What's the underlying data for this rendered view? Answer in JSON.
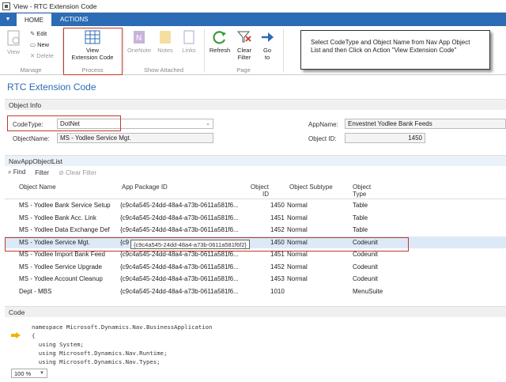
{
  "window": {
    "title": "View - RTC Extension Code"
  },
  "tabs": [
    {
      "label": "HOME"
    },
    {
      "label": "ACTIONS"
    }
  ],
  "ribbon": {
    "view_label": "View",
    "edit_label": "Edit",
    "new_label": "New",
    "delete_label": "Delete",
    "manage_group": "Manage",
    "view_ext_line1": "View",
    "view_ext_line2": "Extension Code",
    "process_group": "Process",
    "onenote_label": "OneNote",
    "notes_label": "Notes",
    "links_label": "Links",
    "show_attached_group": "Show Attached",
    "refresh_label": "Refresh",
    "clear_filter_line1": "Clear",
    "clear_filter_line2": "Filter",
    "goto_line1": "Go",
    "goto_line2": "to",
    "page_group": "Page"
  },
  "callout": {
    "text": "Select CodeType and Object Name from Nav App Object List and then Click on Action \"View Extension Code\""
  },
  "page_title": "RTC Extension Code",
  "object_info": {
    "header": "Object Info",
    "codetype_label": "CodeType:",
    "codetype_value": "DotNet",
    "objectname_label": "ObjectName:",
    "objectname_value": "MS - Yodlee Service Mgt.",
    "appname_label": "AppName:",
    "appname_value": "Envestnet Yodlee Bank Feeds",
    "objectid_label": "Object ID:",
    "objectid_value": "1450"
  },
  "list": {
    "header": "NavAppObjectList",
    "find_label": "Find",
    "filter_label": "Filter",
    "clear_filter_label": "Clear Filter",
    "columns": {
      "object_name": "Object Name",
      "package_id": "App Package ID",
      "object_id_l1": "Object",
      "object_id_l2": "ID",
      "subtype": "Object Subtype",
      "type_l1": "Object",
      "type_l2": "Type"
    },
    "rows": [
      {
        "name": "MS - Yodlee Bank Service Setup",
        "pkg": "{c9c4a545-24dd-48a4-a73b-0611a581f6...",
        "id": "1450",
        "subtype": "Normal",
        "type": "Table"
      },
      {
        "name": "MS - Yodlee Bank Acc. Link",
        "pkg": "{c9c4a545-24dd-48a4-a73b-0611a581f6...",
        "id": "1451",
        "subtype": "Normal",
        "type": "Table"
      },
      {
        "name": "MS - Yodlee Data Exchange Def",
        "pkg": "{c9c4a545-24dd-48a4-a73b-0611a581f6...",
        "id": "1452",
        "subtype": "Normal",
        "type": "Table"
      },
      {
        "name": "MS - Yodlee Service Mgt.",
        "pkg": "{c9",
        "id": "1450",
        "subtype": "Normal",
        "type": "Codeunit"
      },
      {
        "name": "MS - Yodlee Import Bank Feed",
        "pkg": "{c9c4a545-24dd-48a4-a73b-0611a581f6...",
        "id": "1451",
        "subtype": "Normal",
        "type": "Codeunit"
      },
      {
        "name": "MS - Yodlee Service Upgrade",
        "pkg": "{c9c4a545-24dd-48a4-a73b-0611a581f6...",
        "id": "1452",
        "subtype": "Normal",
        "type": "Codeunit"
      },
      {
        "name": "MS - Yodlee Account Cleanup",
        "pkg": "{c9c4a545-24dd-48a4-a73b-0611a581f6...",
        "id": "1453",
        "subtype": "Normal",
        "type": "Codeunit"
      },
      {
        "name": "Dept - MBS",
        "pkg": "{c9c4a545-24dd-48a4-a73b-0611a581f6...",
        "id": "1010",
        "subtype": "",
        "type": "MenuSuite"
      }
    ],
    "tooltip": "{c9c4a545-24dd-48a4-a73b-0611a581f6f2}"
  },
  "code": {
    "header": "Code",
    "lines": [
      "namespace Microsoft.Dynamics.Nav.BusinessApplication",
      "{",
      "  using System;",
      "  using Microsoft.Dynamics.Nav.Runtime;",
      "  using Microsoft.Dynamics.Nav.Types;"
    ]
  },
  "zoom": {
    "value": "100 %"
  },
  "colors": {
    "accent": "#2c6bb5",
    "highlight_box": "#c0392b",
    "selected_row": "#dce9f7",
    "arrow": "#f0b400"
  }
}
